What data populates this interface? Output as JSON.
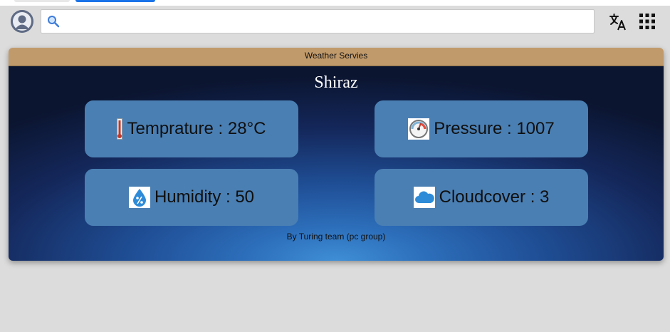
{
  "browser": {
    "search": {
      "value": "",
      "placeholder": ""
    },
    "icons": {
      "avatar": "user-avatar-icon",
      "search": "search-icon",
      "translate": "translate-icon",
      "apps": "apps-grid-icon"
    }
  },
  "widget": {
    "header_title": "Weather Servies",
    "city": "Shiraz",
    "tiles": [
      {
        "icon": "thermometer-icon",
        "label": "Temprature : 28°C"
      },
      {
        "icon": "pressure-gauge-icon",
        "label": "Pressure : 1007"
      },
      {
        "icon": "humidity-drop-icon",
        "label": "Humidity : 50"
      },
      {
        "icon": "cloud-icon",
        "label": "Cloudcover : 3"
      }
    ],
    "footer_credit": "By Turing team (pc group)"
  },
  "colors": {
    "header": "#c19a6b",
    "tile": "#4a7fb3",
    "body_dark": "#0b1530",
    "body_glow": "#3f8fd6",
    "page_bg": "#dcdcdc"
  }
}
